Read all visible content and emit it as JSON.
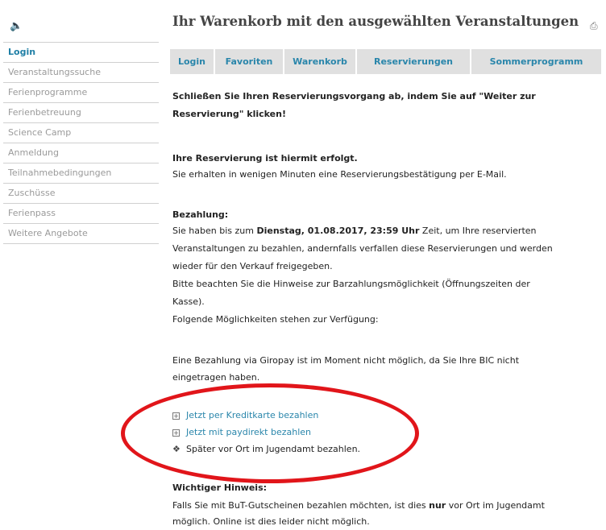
{
  "speaker_icon": "speaker-icon",
  "print_icon": "print-icon",
  "sidebar": {
    "items": [
      {
        "label": "Login",
        "active": true
      },
      {
        "label": "Veranstaltungssuche"
      },
      {
        "label": "Ferienprogramme"
      },
      {
        "label": "Ferienbetreuung"
      },
      {
        "label": "Science Camp"
      },
      {
        "label": "Anmeldung"
      },
      {
        "label": "Teilnahmebedingungen"
      },
      {
        "label": "Zuschüsse"
      },
      {
        "label": "Ferienpass"
      },
      {
        "label": "Weitere Angebote"
      }
    ]
  },
  "main": {
    "title": "Ihr Warenkorb mit den ausgewählten Veranstaltungen",
    "tabs": [
      "Login",
      "Favoriten",
      "Warenkorb",
      "Reservierungen",
      "Sommerprogramm"
    ],
    "intro_line1": "Schließen Sie Ihren Reservierungsvorgang ab, indem Sie auf \"Weiter zur",
    "intro_line2": "Reservierung\" klicken!",
    "confirm_heading": "Ihre Reservierung ist hiermit erfolgt.",
    "confirm_text": "Sie erhalten in wenigen Minuten eine Reservierungsbestätigung per E-Mail.",
    "payment_heading": "Bezahlung:",
    "payment_line1_pre": "Sie haben bis zum ",
    "payment_deadline": "Dienstag, 01.08.2017, 23:59 Uhr",
    "payment_line1_post": " Zeit, um Ihre reservierten",
    "payment_line2": "Veranstaltungen zu bezahlen, andernfalls verfallen diese Reservierungen und werden",
    "payment_line3": "wieder für den Verkauf freigegeben.",
    "payment_line4": "Bitte beachten Sie die Hinweise zur Barzahlungsmöglichkeit (Öffnungszeiten der",
    "payment_line5": "Kasse).",
    "payment_line6": "Folgende Möglichkeiten stehen zur Verfügung:",
    "giropay_line1": "Eine Bezahlung via Giropay ist im Moment nicht möglich, da Sie Ihre BIC nicht",
    "giropay_line2": "eingetragen haben.",
    "options": {
      "credit_card": "Jetzt per Kreditkarte bezahlen",
      "paydirekt": "Jetzt mit paydirekt bezahlen",
      "onsite": "Später vor Ort im Jugendamt bezahlen."
    },
    "notice_heading": "Wichtiger Hinweis:",
    "notice_line1_pre": "Falls Sie mit BuT-Gutscheinen bezahlen möchten, ist dies ",
    "notice_line1_bold": "nur",
    "notice_line1_post": " vor Ort im Jugendamt",
    "notice_line2": "möglich. Online ist dies leider nicht möglich."
  },
  "colors": {
    "accent": "#2a86ab",
    "annotation": "#e1151a"
  }
}
